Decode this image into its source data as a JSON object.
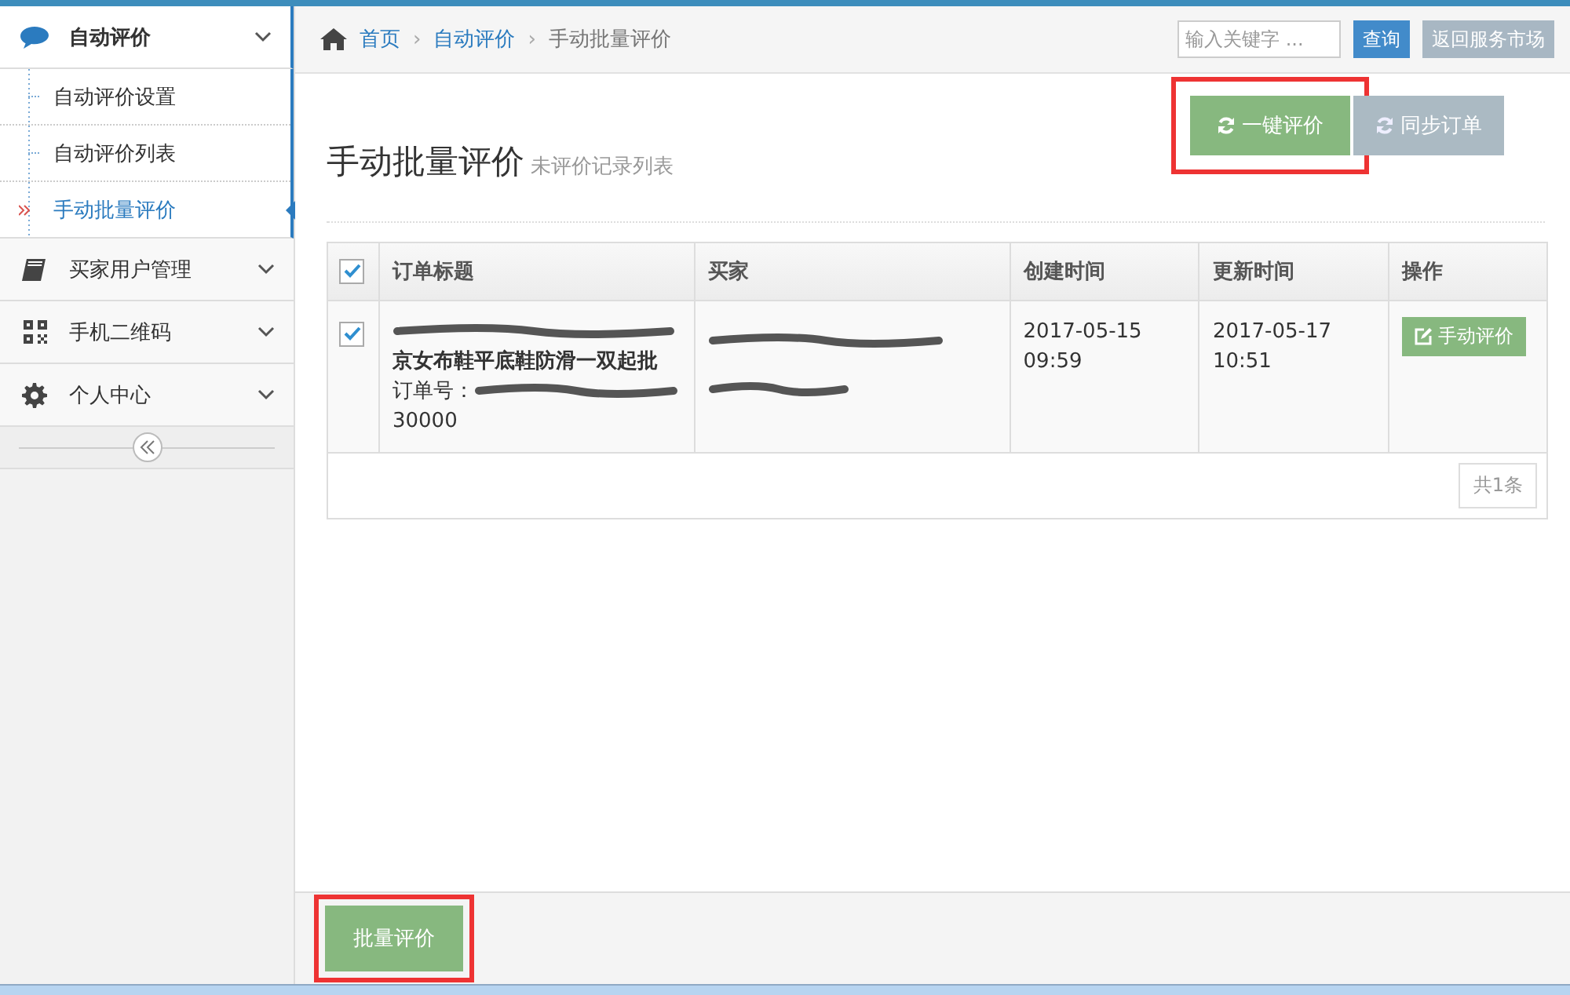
{
  "sidebar": {
    "groups": [
      {
        "kind": "chat",
        "label": "自动评价",
        "expanded": true,
        "children": [
          {
            "label": "自动评价设置",
            "selected": false
          },
          {
            "label": "自动评价列表",
            "selected": false
          },
          {
            "label": "手动批量评价",
            "selected": true
          }
        ]
      },
      {
        "kind": "book",
        "label": "买家用户管理",
        "expanded": false
      },
      {
        "kind": "qr",
        "label": "手机二维码",
        "expanded": false
      },
      {
        "kind": "gear",
        "label": "个人中心",
        "expanded": false
      }
    ]
  },
  "breadcrumb": [
    {
      "label": "首页",
      "current": false
    },
    {
      "separator": "›",
      "label": "自动评价",
      "current": false
    },
    {
      "separator": "›",
      "label": "手动批量评价",
      "current": true
    }
  ],
  "search": {
    "placeholder": "输入关键字 ..."
  },
  "top_buttons": [
    {
      "label": "查询",
      "kind": "primary"
    },
    {
      "label": "返回服务市场",
      "kind": "secondary"
    }
  ],
  "page_title": "手动批量评价",
  "page_subtitle": "未评价记录列表",
  "actions": [
    {
      "label": "一键评价",
      "kind": "primary",
      "annotated": true
    },
    {
      "label": "同步订单",
      "kind": "secondary",
      "annotated": false
    }
  ],
  "table": {
    "all_checked": true,
    "columns": [
      "订单标题",
      "买家",
      "创建时间",
      "更新时间",
      "操作"
    ],
    "rows": [
      {
        "checked": true,
        "title": "京女布鞋平底鞋防滑一双起批",
        "order_label": "订单号：",
        "order_tail": "30000",
        "created": "2017-05-15 09:59",
        "updated": "2017-05-17 10:51",
        "action": "手动评价"
      }
    ]
  },
  "pager": "共1条",
  "footer_button": {
    "label": "批量评价",
    "annotated": true
  }
}
